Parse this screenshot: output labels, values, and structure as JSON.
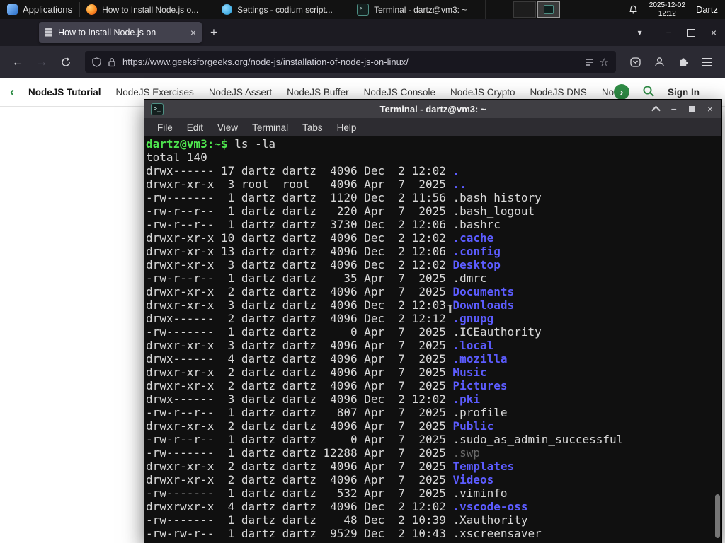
{
  "colors": {
    "gfg_green": "#2f8d46",
    "prompt_green": "#4ee44e",
    "dir_blue": "#5c5cff",
    "dim_file": "#6a6a6a",
    "terminal_text": "#d8d8d8"
  },
  "icons": {
    "close": "×",
    "minimize": "−",
    "new_tab": "+",
    "list_tabs": "▾",
    "back": "←",
    "forward": "→",
    "star": "☆",
    "nav_prev": "‹",
    "nav_next": "›"
  },
  "taskbar": {
    "applications": "Applications",
    "windows": [
      {
        "title": "How to Install Node.js o...",
        "icon": "firefox"
      },
      {
        "title": "Settings - codium script...",
        "icon": "codium"
      },
      {
        "title": "Terminal - dartz@vm3: ~",
        "icon": "terminal"
      }
    ],
    "clock": {
      "date": "2025-12-02",
      "time": "12:12"
    },
    "user": "Dartz"
  },
  "browser": {
    "tab": {
      "title": "How to Install Node.js on"
    },
    "url": "https://www.geeksforgeeks.org/node-js/installation-of-node-js-on-linux/",
    "site_nav": {
      "items": [
        "NodeJS Tutorial",
        "NodeJS Exercises",
        "NodeJS Assert",
        "NodeJS Buffer",
        "NodeJS Console",
        "NodeJS Crypto",
        "NodeJS DNS",
        "Node"
      ],
      "sign_in": "Sign In"
    }
  },
  "terminal": {
    "title": "Terminal - dartz@vm3: ~",
    "menu": [
      "File",
      "Edit",
      "View",
      "Terminal",
      "Tabs",
      "Help"
    ],
    "prompt": "dartz@vm3:~$",
    "command": "ls -la",
    "total": "total 140",
    "rows": [
      {
        "pre": "drwx------ 17 dartz dartz  4096 Dec  2 12:02 ",
        "name": ".",
        "type": "dir"
      },
      {
        "pre": "drwxr-xr-x  3 root  root   4096 Apr  7  2025 ",
        "name": "..",
        "type": "dir"
      },
      {
        "pre": "-rw-------  1 dartz dartz  1120 Dec  2 11:56 ",
        "name": ".bash_history",
        "type": "file"
      },
      {
        "pre": "-rw-r--r--  1 dartz dartz   220 Apr  7  2025 ",
        "name": ".bash_logout",
        "type": "file"
      },
      {
        "pre": "-rw-r--r--  1 dartz dartz  3730 Dec  2 12:06 ",
        "name": ".bashrc",
        "type": "file"
      },
      {
        "pre": "drwxr-xr-x 10 dartz dartz  4096 Dec  2 12:02 ",
        "name": ".cache",
        "type": "dir"
      },
      {
        "pre": "drwxr-xr-x 13 dartz dartz  4096 Dec  2 12:06 ",
        "name": ".config",
        "type": "dir"
      },
      {
        "pre": "drwxr-xr-x  3 dartz dartz  4096 Dec  2 12:02 ",
        "name": "Desktop",
        "type": "dir"
      },
      {
        "pre": "-rw-r--r--  1 dartz dartz    35 Apr  7  2025 ",
        "name": ".dmrc",
        "type": "file"
      },
      {
        "pre": "drwxr-xr-x  2 dartz dartz  4096 Apr  7  2025 ",
        "name": "Documents",
        "type": "dir"
      },
      {
        "pre": "drwxr-xr-x  3 dartz dartz  4096 Dec  2 12:03 ",
        "name": "Downloads",
        "type": "dir"
      },
      {
        "pre": "drwx------  2 dartz dartz  4096 Dec  2 12:12 ",
        "name": ".gnupg",
        "type": "dir"
      },
      {
        "pre": "-rw-------  1 dartz dartz     0 Apr  7  2025 ",
        "name": ".ICEauthority",
        "type": "file"
      },
      {
        "pre": "drwxr-xr-x  3 dartz dartz  4096 Apr  7  2025 ",
        "name": ".local",
        "type": "dir"
      },
      {
        "pre": "drwx------  4 dartz dartz  4096 Apr  7  2025 ",
        "name": ".mozilla",
        "type": "dir"
      },
      {
        "pre": "drwxr-xr-x  2 dartz dartz  4096 Apr  7  2025 ",
        "name": "Music",
        "type": "dir"
      },
      {
        "pre": "drwxr-xr-x  2 dartz dartz  4096 Apr  7  2025 ",
        "name": "Pictures",
        "type": "dir"
      },
      {
        "pre": "drwx------  3 dartz dartz  4096 Dec  2 12:02 ",
        "name": ".pki",
        "type": "dir"
      },
      {
        "pre": "-rw-r--r--  1 dartz dartz   807 Apr  7  2025 ",
        "name": ".profile",
        "type": "file"
      },
      {
        "pre": "drwxr-xr-x  2 dartz dartz  4096 Apr  7  2025 ",
        "name": "Public",
        "type": "dir"
      },
      {
        "pre": "-rw-r--r--  1 dartz dartz     0 Apr  7  2025 ",
        "name": ".sudo_as_admin_successful",
        "type": "file"
      },
      {
        "pre": "-rw-------  1 dartz dartz 12288 Apr  7  2025 ",
        "name": ".swp",
        "type": "dim"
      },
      {
        "pre": "drwxr-xr-x  2 dartz dartz  4096 Apr  7  2025 ",
        "name": "Templates",
        "type": "dir"
      },
      {
        "pre": "drwxr-xr-x  2 dartz dartz  4096 Apr  7  2025 ",
        "name": "Videos",
        "type": "dir"
      },
      {
        "pre": "-rw-------  1 dartz dartz   532 Apr  7  2025 ",
        "name": ".viminfo",
        "type": "file"
      },
      {
        "pre": "drwxrwxr-x  4 dartz dartz  4096 Dec  2 12:02 ",
        "name": ".vscode-oss",
        "type": "dir"
      },
      {
        "pre": "-rw-------  1 dartz dartz    48 Dec  2 10:39 ",
        "name": ".Xauthority",
        "type": "file"
      },
      {
        "pre": "-rw-rw-r--  1 dartz dartz  9529 Dec  2 10:43 ",
        "name": ".xscreensaver",
        "type": "file"
      }
    ]
  }
}
